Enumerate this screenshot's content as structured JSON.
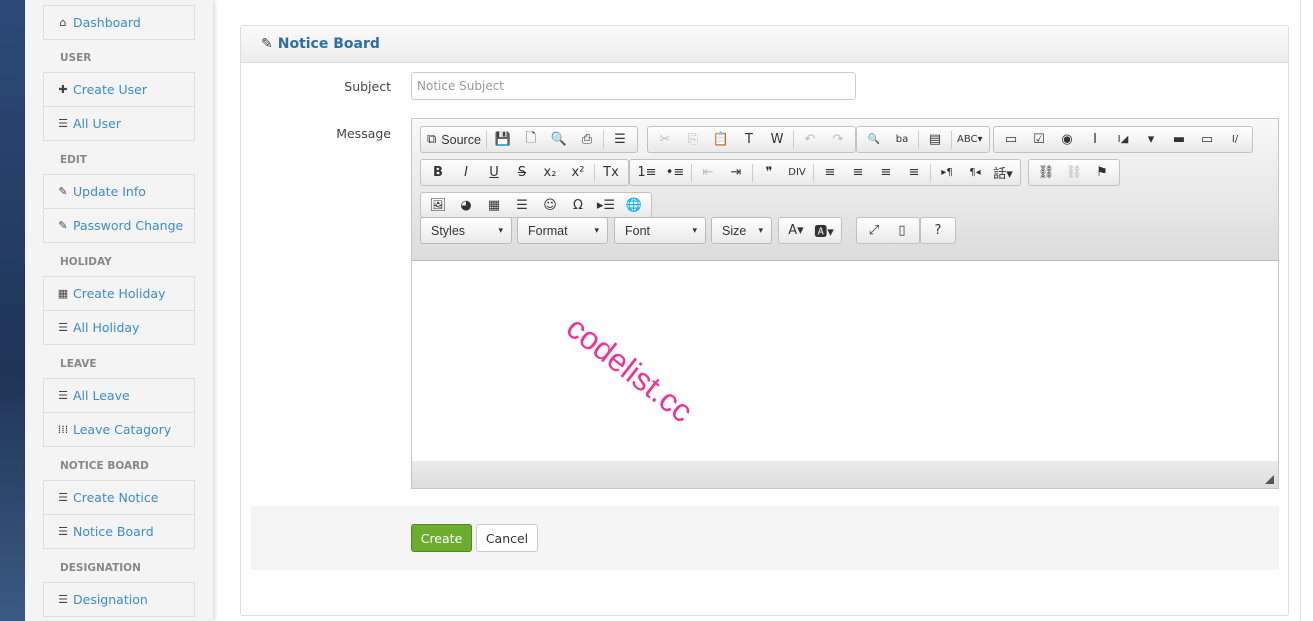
{
  "sidebar": {
    "dashboard": "Dashboard",
    "sections": [
      {
        "title": "USER",
        "items": [
          {
            "label": "Create User",
            "icon": "plus-icon"
          },
          {
            "label": "All User",
            "icon": "list-icon"
          }
        ]
      },
      {
        "title": "EDIT",
        "items": [
          {
            "label": "Update Info",
            "icon": "edit-icon"
          },
          {
            "label": "Password Change",
            "icon": "edit-icon"
          }
        ]
      },
      {
        "title": "HOLIDAY",
        "items": [
          {
            "label": "Create Holiday",
            "icon": "calendar-icon"
          },
          {
            "label": "All Holiday",
            "icon": "list-icon"
          }
        ]
      },
      {
        "title": "LEAVE",
        "items": [
          {
            "label": "All Leave",
            "icon": "list-icon"
          },
          {
            "label": "Leave Catagory",
            "icon": "grid-icon"
          }
        ]
      },
      {
        "title": "NOTICE BOARD",
        "items": [
          {
            "label": "Create Notice",
            "icon": "list-icon"
          },
          {
            "label": "Notice Board",
            "icon": "list-icon"
          }
        ]
      },
      {
        "title": "DESIGNATION",
        "items": [
          {
            "label": "Designation",
            "icon": "list-icon"
          }
        ]
      }
    ]
  },
  "panel": {
    "title": "Notice Board",
    "subject_label": "Subject",
    "subject_placeholder": "Notice Subject",
    "subject_value": "",
    "message_label": "Message",
    "create": "Create",
    "cancel": "Cancel"
  },
  "editor": {
    "source_label": "Source",
    "combos": [
      "Styles",
      "Format",
      "Font",
      "Size"
    ],
    "watermark": "codelist.cc"
  }
}
